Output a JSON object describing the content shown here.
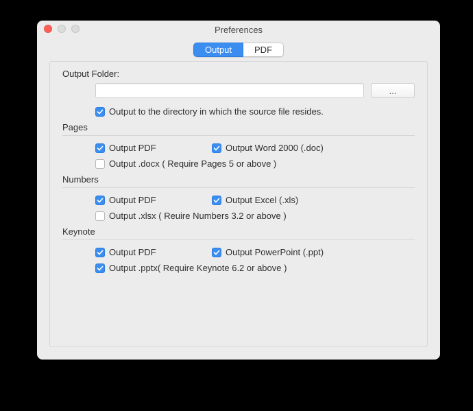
{
  "window": {
    "title": "Preferences"
  },
  "tabs": {
    "output": "Output",
    "pdf": "PDF"
  },
  "outputFolder": {
    "label": "Output Folder:",
    "value": "",
    "browse": "...",
    "sameDirLabel": "Output to the directory in which the source file resides."
  },
  "pages": {
    "heading": "Pages",
    "pdf": "Output PDF",
    "word": "Output Word 2000 (.doc)",
    "docx": "Output .docx ( Require Pages 5 or above )"
  },
  "numbers": {
    "heading": "Numbers",
    "pdf": "Output PDF",
    "excel": "Output Excel (.xls)",
    "xlsx": "Output .xlsx ( Reuire Numbers 3.2 or above )"
  },
  "keynote": {
    "heading": "Keynote",
    "pdf": "Output PDF",
    "ppt": "Output PowerPoint (.ppt)",
    "pptx": "Output .pptx( Require Keynote 6.2 or above )"
  }
}
